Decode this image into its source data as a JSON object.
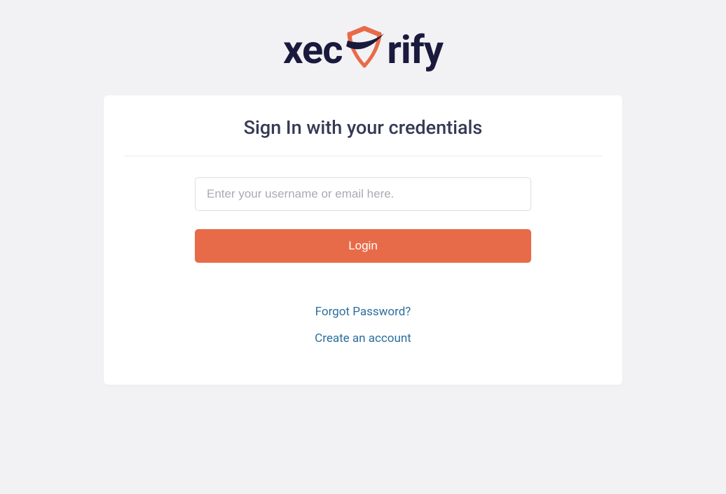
{
  "brand": {
    "name_left": "xec",
    "name_right": "rify",
    "icon": "shield-check-icon",
    "colors": {
      "text": "#1a1a3e",
      "shield_outline": "#e86b49",
      "shield_swoosh": "#1a1a3e"
    }
  },
  "card": {
    "title": "Sign In with your credentials"
  },
  "form": {
    "username": {
      "placeholder": "Enter your username or email here.",
      "value": ""
    },
    "login_label": "Login"
  },
  "links": {
    "forgot_password": "Forgot Password?",
    "create_account": "Create an account"
  }
}
